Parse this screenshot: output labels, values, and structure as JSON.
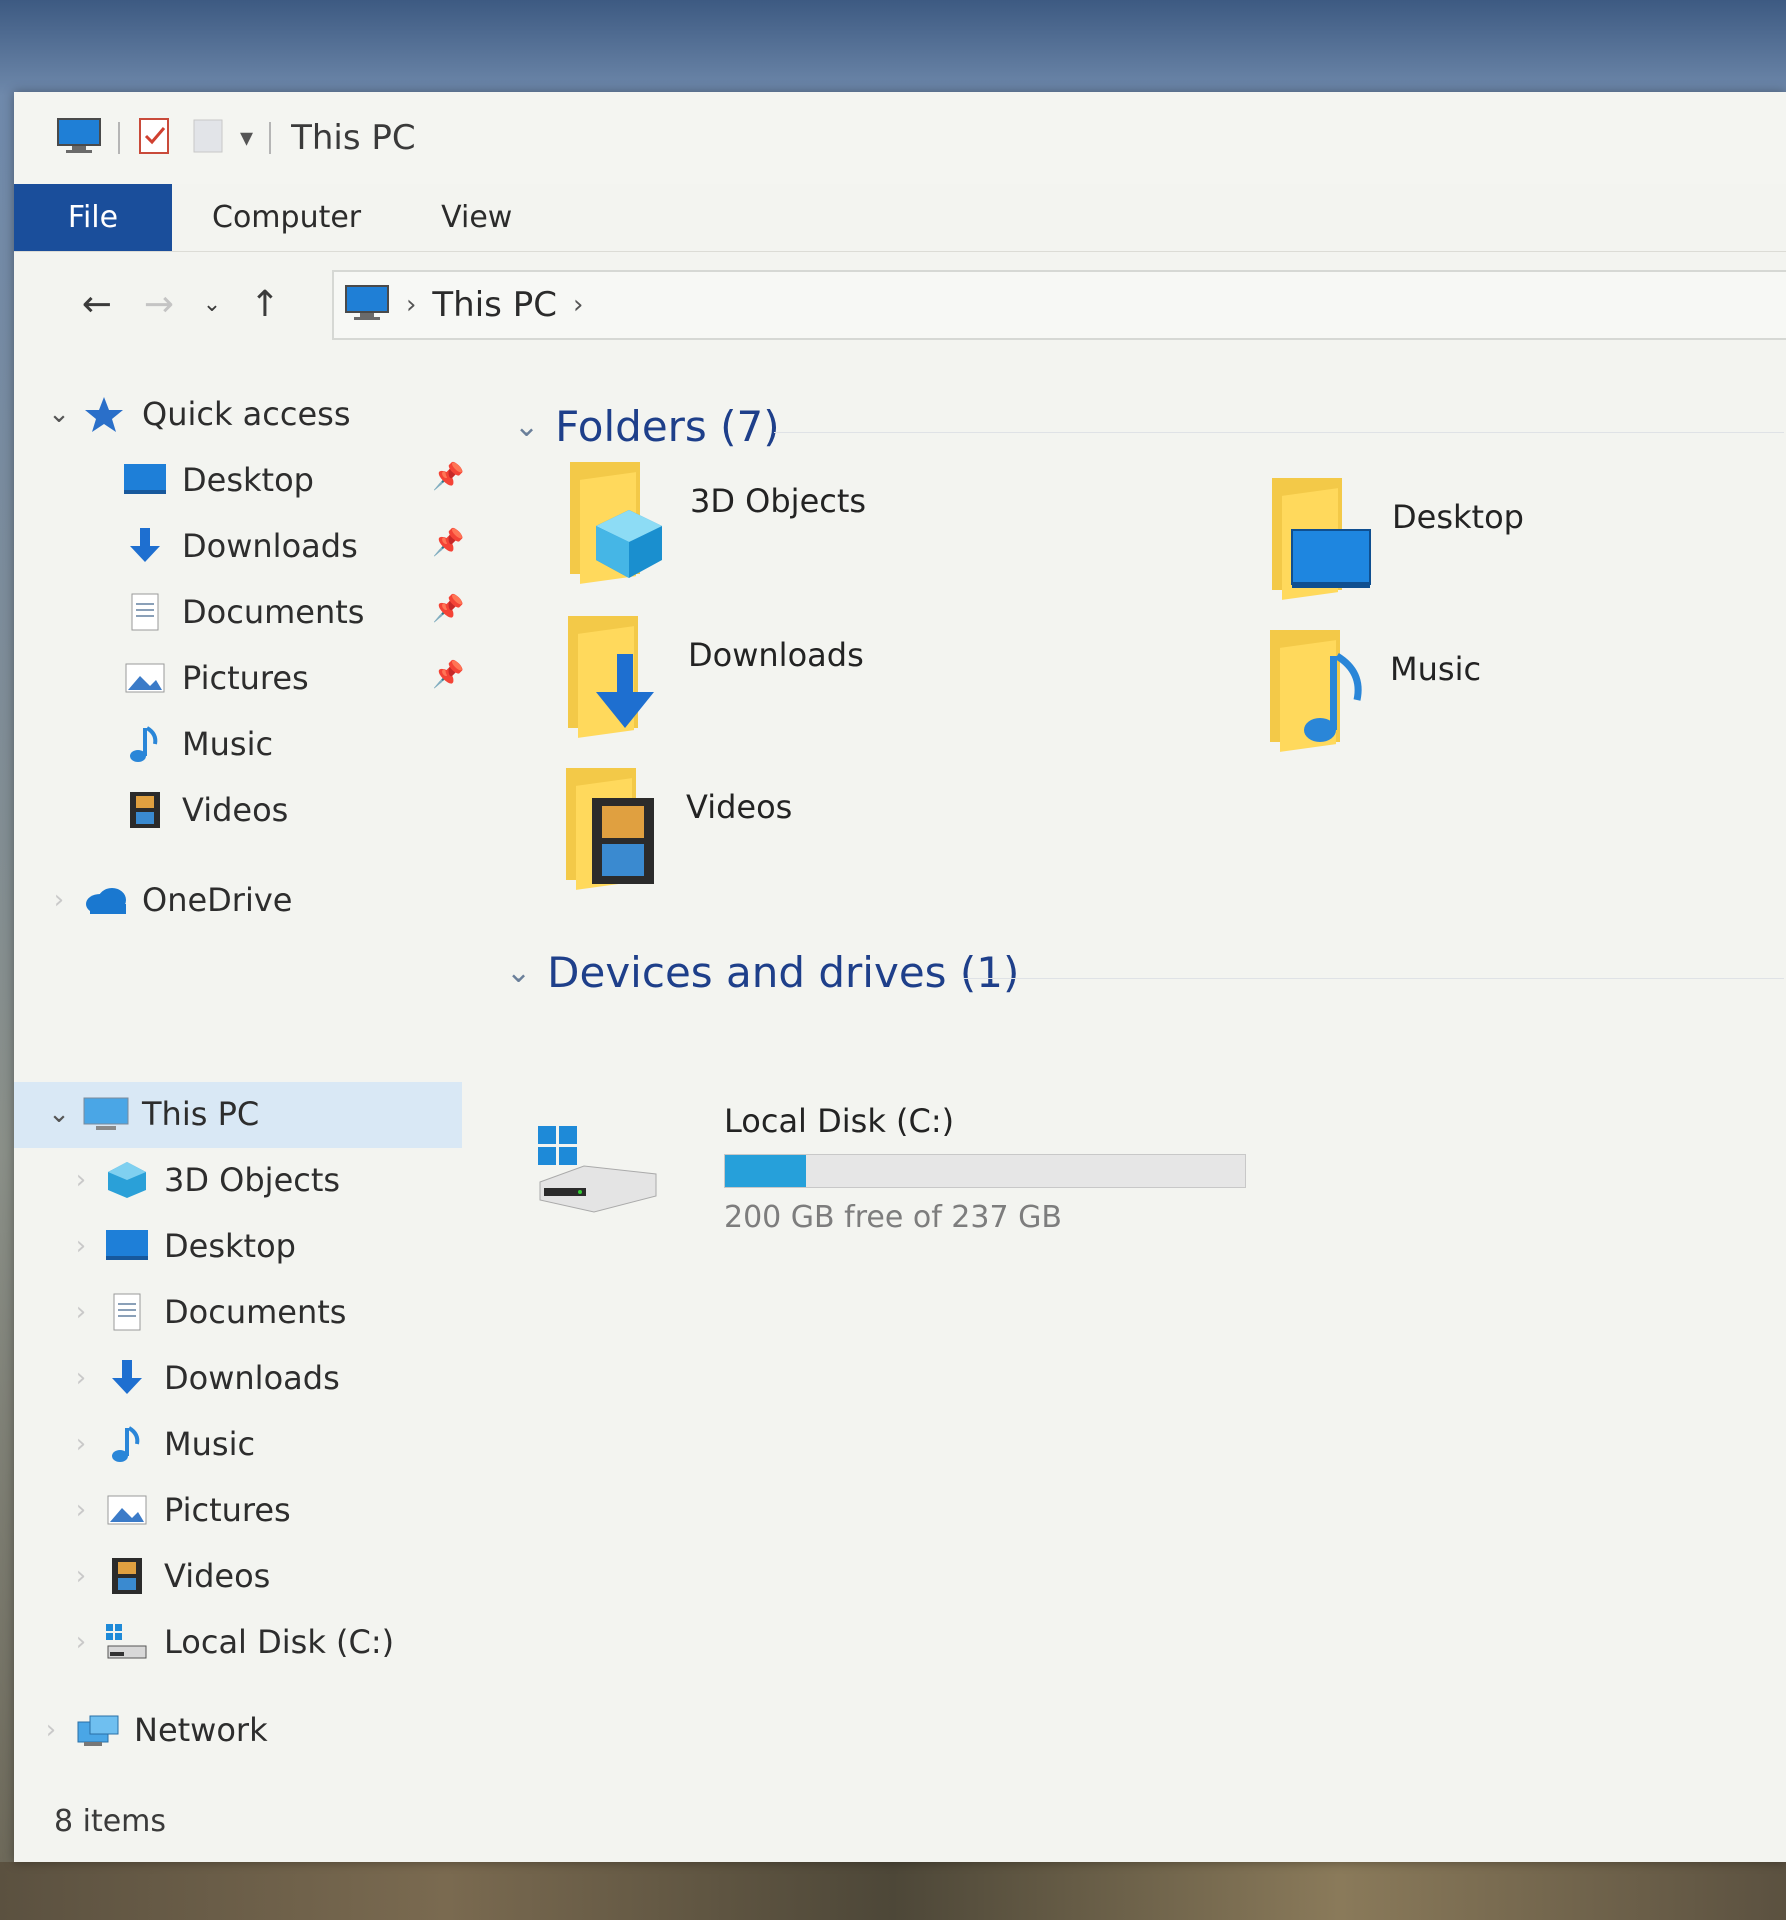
{
  "window": {
    "title": "This PC"
  },
  "ribbon": {
    "tabs": [
      "File",
      "Computer",
      "View"
    ]
  },
  "navigation": {
    "back_icon": "arrow-left-icon",
    "forward_icon": "arrow-right-icon",
    "recent_icon": "chevron-down-icon",
    "up_icon": "arrow-up-icon"
  },
  "address": {
    "crumbs": [
      "This PC"
    ]
  },
  "navpane": {
    "quick_access": {
      "label": "Quick access",
      "items": [
        {
          "label": "Desktop",
          "icon": "desktop-icon",
          "pinned": true
        },
        {
          "label": "Downloads",
          "icon": "downloads-icon",
          "pinned": true
        },
        {
          "label": "Documents",
          "icon": "documents-icon",
          "pinned": true
        },
        {
          "label": "Pictures",
          "icon": "pictures-icon",
          "pinned": true
        },
        {
          "label": "Music",
          "icon": "music-icon",
          "pinned": false
        },
        {
          "label": "Videos",
          "icon": "videos-icon",
          "pinned": false
        }
      ]
    },
    "onedrive": {
      "label": "OneDrive",
      "icon": "onedrive-icon"
    },
    "this_pc": {
      "label": "This PC",
      "icon": "computer-icon",
      "items": [
        {
          "label": "3D Objects",
          "icon": "3d-objects-icon"
        },
        {
          "label": "Desktop",
          "icon": "desktop-icon"
        },
        {
          "label": "Documents",
          "icon": "documents-icon"
        },
        {
          "label": "Downloads",
          "icon": "downloads-icon"
        },
        {
          "label": "Music",
          "icon": "music-icon"
        },
        {
          "label": "Pictures",
          "icon": "pictures-icon"
        },
        {
          "label": "Videos",
          "icon": "videos-icon"
        },
        {
          "label": "Local Disk (C:)",
          "icon": "drive-icon"
        }
      ]
    },
    "network": {
      "label": "Network",
      "icon": "network-icon"
    }
  },
  "content": {
    "folders_header": "Folders (7)",
    "folders": [
      {
        "label": "3D Objects",
        "icon": "3d-objects-icon"
      },
      {
        "label": "Desktop",
        "icon": "desktop-icon"
      },
      {
        "label": "Downloads",
        "icon": "downloads-icon"
      },
      {
        "label": "Music",
        "icon": "music-icon"
      },
      {
        "label": "Videos",
        "icon": "videos-icon"
      }
    ],
    "devices_header": "Devices and drives (1)",
    "drive": {
      "label": "Local Disk (C:)",
      "free_text": "200 GB free of 237 GB",
      "used_fraction": 0.156
    }
  },
  "status": {
    "items_text": "8 items"
  },
  "colors": {
    "accent": "#1a4e9b",
    "header_text": "#1e3f8a",
    "folder_yellow": "#ffd95c",
    "drive_bar": "#26a0da",
    "selection": "#d9e8f5"
  }
}
